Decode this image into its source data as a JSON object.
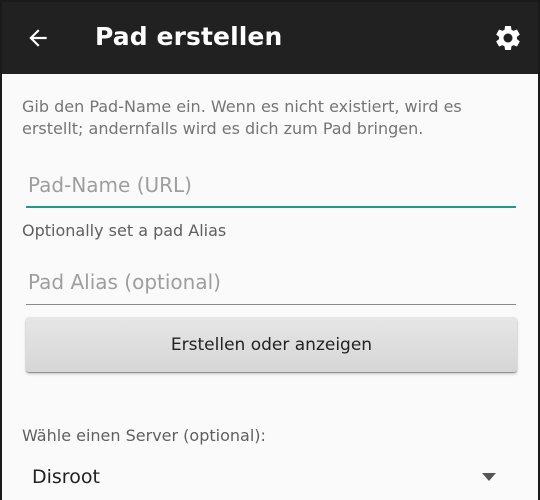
{
  "appbar": {
    "title": "Pad erstellen",
    "back_icon": "arrow-back-icon",
    "settings_icon": "gear-icon",
    "background": "#212121"
  },
  "intro_text": "Gib den Pad-Name ein. Wenn es nicht existiert, wird es erstellt; andernfalls wird es dich zum Pad bringen.",
  "pad_name": {
    "placeholder": "Pad-Name (URL)",
    "value": "",
    "accent": "#1a9c89"
  },
  "alias_hint": "Optionally set a pad Alias",
  "pad_alias": {
    "placeholder": "Pad Alias (optional)",
    "value": ""
  },
  "create_button_label": "Erstellen oder anzeigen",
  "server": {
    "label": "Wähle einen Server (optional):",
    "selected": "Disroot",
    "caret_icon": "dropdown-caret-icon"
  }
}
